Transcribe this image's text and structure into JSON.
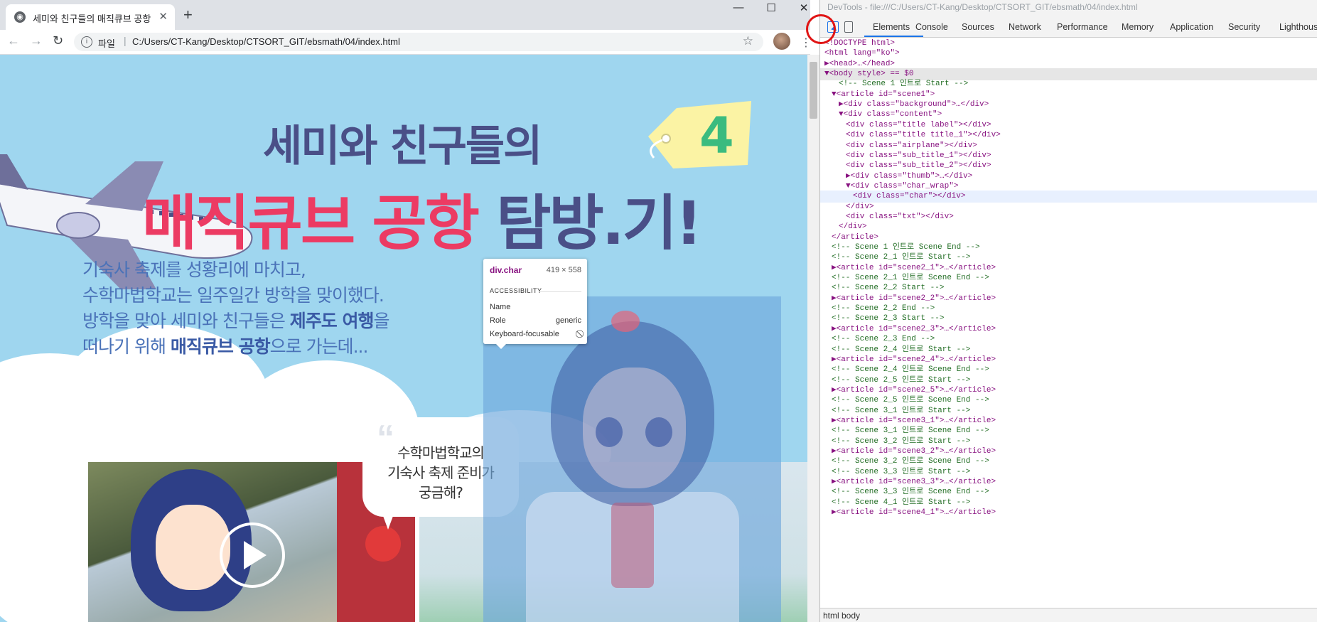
{
  "browser": {
    "tab_title": "세미와 친구들의 매직큐브 공항 탐방",
    "new_tab": "+",
    "window_controls": {
      "minimize": "—",
      "maximize": "☐",
      "close": "✕"
    },
    "nav": {
      "back": "←",
      "forward": "→",
      "reload": "↻"
    },
    "address": {
      "scheme_label": "파일",
      "url": "C:/Users/CT-Kang/Desktop/CTSORT_GIT/ebsmath/04/index.html"
    },
    "icons": {
      "info": "i",
      "star": "☆",
      "menu": "⋮"
    }
  },
  "page": {
    "badge_number": "4",
    "title_line1": "세미와 친구들의",
    "title_line2_main": "매직큐브 공항",
    "title_line2_tail": "탐방.기!",
    "desc": [
      "기숙사 축제를 성황리에 마치고,",
      "수학마법학교는 일주일간 방학을 맞이했다."
    ],
    "desc2_line1_pre": "방학을 맞아 세미와 친구들은 ",
    "desc2_line1_bold": "제주도 여행",
    "desc2_line1_post": "을",
    "desc2_line2_pre": "떠나기 위해 ",
    "desc2_line2_bold": "매직큐브 공항",
    "desc2_line2_post": "으로 가는데...",
    "bubble_lines": [
      "수학마법학교의",
      "기숙사 축제 준비가",
      "궁금해?"
    ],
    "bubble_quote": "“"
  },
  "inspect_tooltip": {
    "selector": "div.char",
    "dimensions": "419 × 558",
    "section": "ACCESSIBILITY",
    "rows": [
      {
        "key": "Name",
        "value": ""
      },
      {
        "key": "Role",
        "value": "generic"
      },
      {
        "key": "Keyboard-focusable",
        "value": "⃠"
      }
    ]
  },
  "devtools": {
    "title": "DevTools - file:///C:/Users/CT-Kang/Desktop/CTSORT_GIT/ebsmath/04/index.html",
    "tabs": [
      "Elements",
      "Console",
      "Sources",
      "Network",
      "Performance",
      "Memory",
      "Application",
      "Security",
      "Lighthouse"
    ],
    "active_tab": "Elements",
    "dom_lines": [
      "<!DOCTYPE html>",
      "<html lang=\"ko\">",
      "▶<head>…</head>",
      "▼<body style> == $0",
      "<!-- Scene 1 인트로 Start -->",
      "▼<article id=\"scene1\">",
      "▶<div class=\"background\">…</div>",
      "▼<div class=\"content\">",
      "<div class=\"title label\"></div>",
      "<div class=\"title title_1\"></div>",
      "<div class=\"airplane\"></div>",
      "<div class=\"sub_title_1\"></div>",
      "<div class=\"sub_title_2\"></div>",
      "▶<div class=\"thumb\">…</div>",
      "▼<div class=\"char_wrap\">",
      "<div class=\"char\"></div>",
      "</div>",
      "<div class=\"txt\"></div>",
      "</div>",
      "</article>",
      "<!-- Scene 1 인트로 Scene End -->",
      "<!-- Scene 2_1 인트로 Start -->",
      "▶<article id=\"scene2_1\">…</article>",
      "<!-- Scene 2_1 인트로 Scene End -->",
      "<!-- Scene 2_2 Start -->",
      "▶<article id=\"scene2_2\">…</article>",
      "<!-- Scene 2_2 End -->",
      "<!-- Scene 2_3 Start -->",
      "▶<article id=\"scene2_3\">…</article>",
      "<!-- Scene 2_3 End -->",
      "<!-- Scene 2_4 인트로 Start -->",
      "▶<article id=\"scene2_4\">…</article>",
      "<!-- Scene 2_4 인트로 Scene End -->",
      "<!-- Scene 2_5 인트로 Start -->",
      "▶<article id=\"scene2_5\">…</article>",
      "<!-- Scene 2_5 인트로 Scene End -->",
      "<!-- Scene 3_1 인트로 Start -->",
      "▶<article id=\"scene3_1\">…</article>",
      "<!-- Scene 3_1 인트로 Scene End -->",
      "<!-- Scene 3_2 인트로 Start -->",
      "▶<article id=\"scene3_2\">…</article>",
      "<!-- Scene 3_2 인트로 Scene End -->",
      "<!-- Scene 3_3 인트로 Start -->",
      "▶<article id=\"scene3_3\">…</article>",
      "<!-- Scene 3_3 인트로 Scene End -->",
      "<!-- Scene 4_1 인트로 Start -->",
      "▶<article id=\"scene4_1\">…</article>"
    ],
    "breadcrumbs": [
      "html",
      "body"
    ]
  },
  "colors": {
    "sky": "#9fd6ef",
    "title_navy": "#4a4f87",
    "title_pink": "#ec3b63",
    "desc_blue": "#4a72b8",
    "highlight": "#6fa8dc",
    "red_annotation": "#e01515"
  }
}
